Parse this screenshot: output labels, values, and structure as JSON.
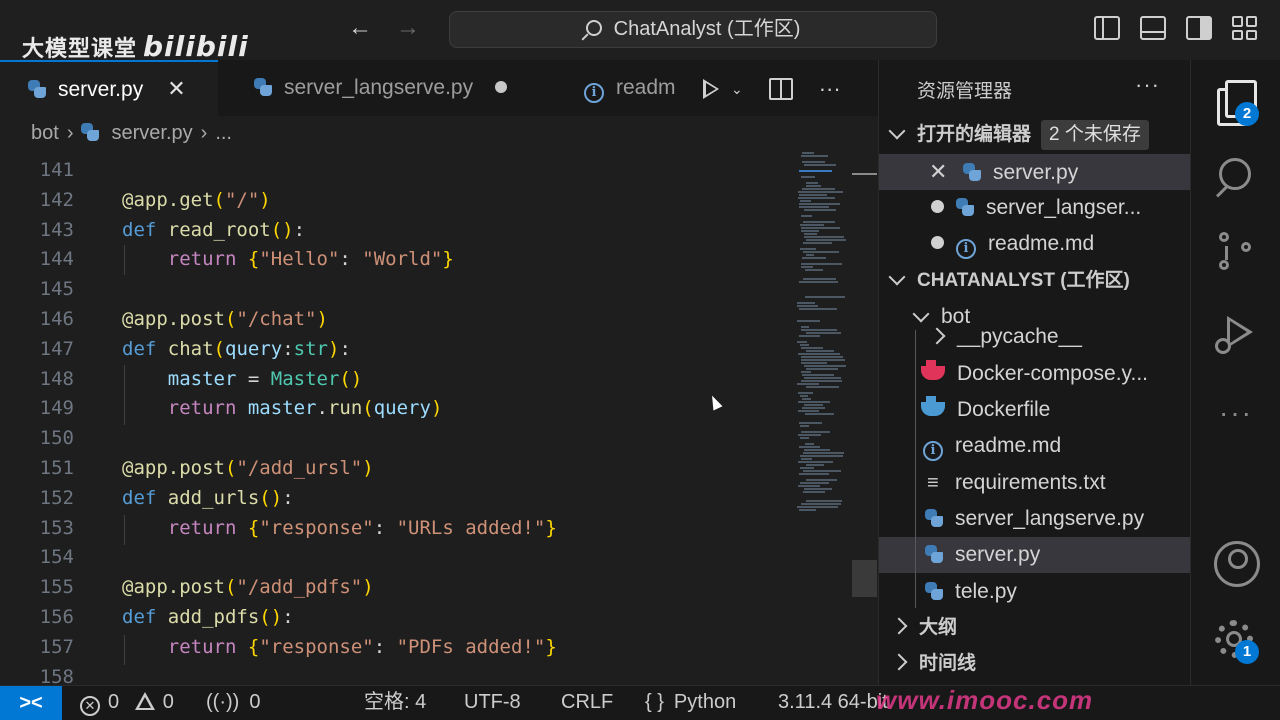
{
  "brand": {
    "text": "大模型课堂",
    "logo": "bilibili"
  },
  "titlebar": {
    "command_center": "ChatAnalyst (工作区)",
    "back_icon": "arrow-left-icon",
    "forward_icon": "arrow-right-icon"
  },
  "tabs": [
    {
      "label": "server.py",
      "active": true,
      "state": "close"
    },
    {
      "label": "server_langserve.py",
      "active": false,
      "state": "modified"
    },
    {
      "label": "readm",
      "active": false,
      "state": "none"
    }
  ],
  "breadcrumb": {
    "folder": "bot",
    "file": "server.py",
    "rest": "..."
  },
  "editor": {
    "lines": [
      {
        "n": "141",
        "html": ""
      },
      {
        "n": "142",
        "html": "<span class=\"c-dec\">@app.get</span><span class=\"c-p1\">(</span><span class=\"c-str\">\"/\"</span><span class=\"c-p1\">)</span>"
      },
      {
        "n": "143",
        "html": "<span class=\"c-def\">def</span> <span class=\"c-fn\">read_root</span><span class=\"c-p1\">()</span><span class=\"c-plain\">:</span>"
      },
      {
        "n": "144",
        "html": "    <span class=\"c-kw\">return</span> <span class=\"c-p1\">{</span><span class=\"c-str\">\"Hello\"</span><span class=\"c-plain\">: </span><span class=\"c-str\">\"World\"</span><span class=\"c-p1\">}</span>"
      },
      {
        "n": "145",
        "html": ""
      },
      {
        "n": "146",
        "html": "<span class=\"c-dec\">@app.post</span><span class=\"c-p1\">(</span><span class=\"c-str\">\"/chat\"</span><span class=\"c-p1\">)</span>"
      },
      {
        "n": "147",
        "html": "<span class=\"c-def\">def</span> <span class=\"c-fn\">chat</span><span class=\"c-p1\">(</span><span class=\"c-var\">query</span><span class=\"c-plain\">:</span><span class=\"c-cls\">str</span><span class=\"c-p1\">)</span><span class=\"c-plain\">:</span>"
      },
      {
        "n": "148",
        "html": "    <span class=\"c-var\">master</span> <span class=\"c-plain\">=</span> <span class=\"c-cls\">Master</span><span class=\"c-p1\">()</span>"
      },
      {
        "n": "149",
        "html": "    <span class=\"c-kw\">return</span> <span class=\"c-var\">master</span><span class=\"c-plain\">.</span><span class=\"c-fn\">run</span><span class=\"c-p1\">(</span><span class=\"c-var\">query</span><span class=\"c-p1\">)</span>"
      },
      {
        "n": "150",
        "html": ""
      },
      {
        "n": "151",
        "html": "<span class=\"c-dec\">@app.post</span><span class=\"c-p1\">(</span><span class=\"c-str\">\"/add_ursl\"</span><span class=\"c-p1\">)</span>"
      },
      {
        "n": "152",
        "html": "<span class=\"c-def\">def</span> <span class=\"c-fn\">add_urls</span><span class=\"c-p1\">()</span><span class=\"c-plain\">:</span>"
      },
      {
        "n": "153",
        "html": "    <span class=\"c-kw\">return</span> <span class=\"c-p1\">{</span><span class=\"c-str\">\"response\"</span><span class=\"c-plain\">: </span><span class=\"c-str\">\"URLs added!\"</span><span class=\"c-p1\">}</span>"
      },
      {
        "n": "154",
        "html": ""
      },
      {
        "n": "155",
        "html": "<span class=\"c-dec\">@app.post</span><span class=\"c-p1\">(</span><span class=\"c-str\">\"/add_pdfs\"</span><span class=\"c-p1\">)</span>"
      },
      {
        "n": "156",
        "html": "<span class=\"c-def\">def</span> <span class=\"c-fn\">add_pdfs</span><span class=\"c-p1\">()</span><span class=\"c-plain\">:</span>"
      },
      {
        "n": "157",
        "html": "    <span class=\"c-kw\">return</span> <span class=\"c-p1\">{</span><span class=\"c-str\">\"response\"</span><span class=\"c-plain\">: </span><span class=\"c-str\">\"PDFs added!\"</span><span class=\"c-p1\">}</span>"
      },
      {
        "n": "158",
        "html": ""
      }
    ]
  },
  "explorer": {
    "title": "资源管理器",
    "open_editors": {
      "label": "打开的编辑器",
      "badge": "2 个未保存",
      "items": [
        {
          "label": "server.py",
          "marker": "close",
          "icon": "python"
        },
        {
          "label": "server_langser...",
          "marker": "dot",
          "icon": "python"
        },
        {
          "label": "readme.md",
          "marker": "dot",
          "icon": "info"
        }
      ]
    },
    "workspace": {
      "label": "CHATANALYST (工作区)",
      "folder": "bot",
      "items": [
        {
          "label": "__pycache__",
          "icon": "chevron"
        },
        {
          "label": "Docker-compose.y...",
          "icon": "docker-red"
        },
        {
          "label": "Dockerfile",
          "icon": "docker-blue"
        },
        {
          "label": "readme.md",
          "icon": "info"
        },
        {
          "label": "requirements.txt",
          "icon": "text"
        },
        {
          "label": "server_langserve.py",
          "icon": "python"
        },
        {
          "label": "server.py",
          "icon": "python",
          "selected": true
        },
        {
          "label": "tele.py",
          "icon": "python"
        }
      ]
    },
    "outline": "大纲",
    "timeline": "时间线"
  },
  "activity": {
    "explorer_badge": "2",
    "settings_badge": "1"
  },
  "status": {
    "errors": "0",
    "warnings": "0",
    "ports": "0",
    "indent": "空格: 4",
    "encoding": "UTF-8",
    "eol": "CRLF",
    "language": "Python",
    "interpreter": "3.11.4 64-bit"
  },
  "watermark": "www.imooc.com"
}
